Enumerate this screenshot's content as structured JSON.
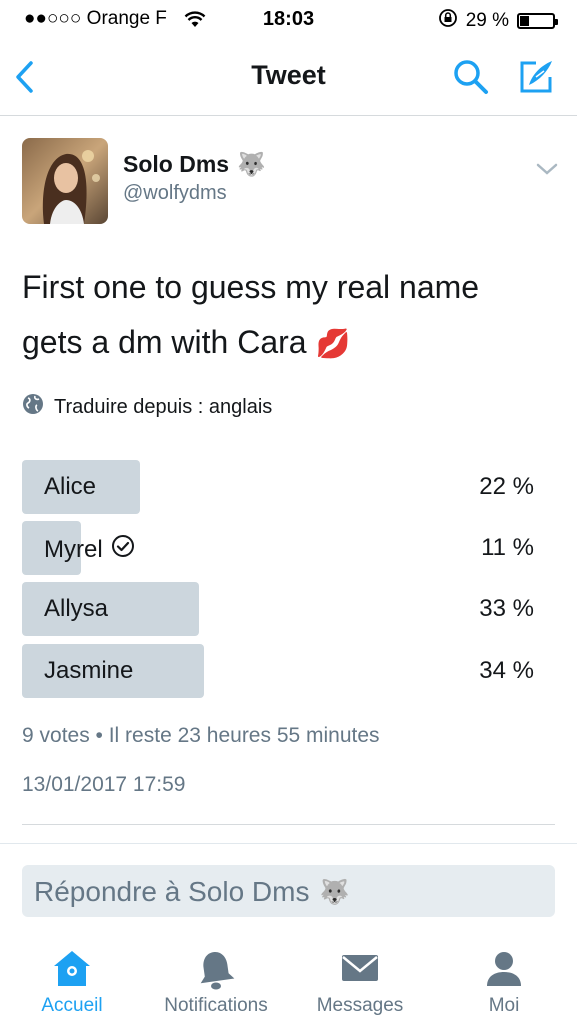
{
  "status_bar": {
    "carrier": "●●○○○ Orange F",
    "time": "18:03",
    "battery": "29 %"
  },
  "nav": {
    "title": "Tweet",
    "back_icon": "chevron-left-icon",
    "search_icon": "search-icon",
    "compose_icon": "compose-icon"
  },
  "tweet": {
    "display_name": "Solo Dms",
    "name_emoji": "🐺",
    "handle": "@wolfydms",
    "text_line1": "First one to guess my real name",
    "text_line2": "gets a dm with Cara",
    "text_emoji": "💋",
    "translate_label": "Traduire depuis : anglais",
    "poll": {
      "options": [
        {
          "label": "Alice",
          "percent_text": "22 %",
          "fraction": 0.22,
          "selected": false
        },
        {
          "label": "Myrel",
          "percent_text": "11 %",
          "fraction": 0.11,
          "selected": true
        },
        {
          "label": "Allysa",
          "percent_text": "33 %",
          "fraction": 0.33,
          "selected": false
        },
        {
          "label": "Jasmine",
          "percent_text": "34 %",
          "fraction": 0.34,
          "selected": false
        }
      ],
      "meta": "9 votes • Il reste 23 heures 55 minutes"
    },
    "timestamp": "13/01/2017 17:59"
  },
  "reply": {
    "placeholder": "Répondre à Solo Dms",
    "emoji": "🐺"
  },
  "tabs": [
    {
      "label": "Accueil",
      "icon": "home-icon",
      "active": true
    },
    {
      "label": "Notifications",
      "icon": "bell-icon",
      "active": false
    },
    {
      "label": "Messages",
      "icon": "envelope-icon",
      "active": false
    },
    {
      "label": "Moi",
      "icon": "person-icon",
      "active": false
    }
  ],
  "colors": {
    "accent": "#1da1f2",
    "poll_bar": "#ccd6dd",
    "secondary_text": "#657786"
  }
}
